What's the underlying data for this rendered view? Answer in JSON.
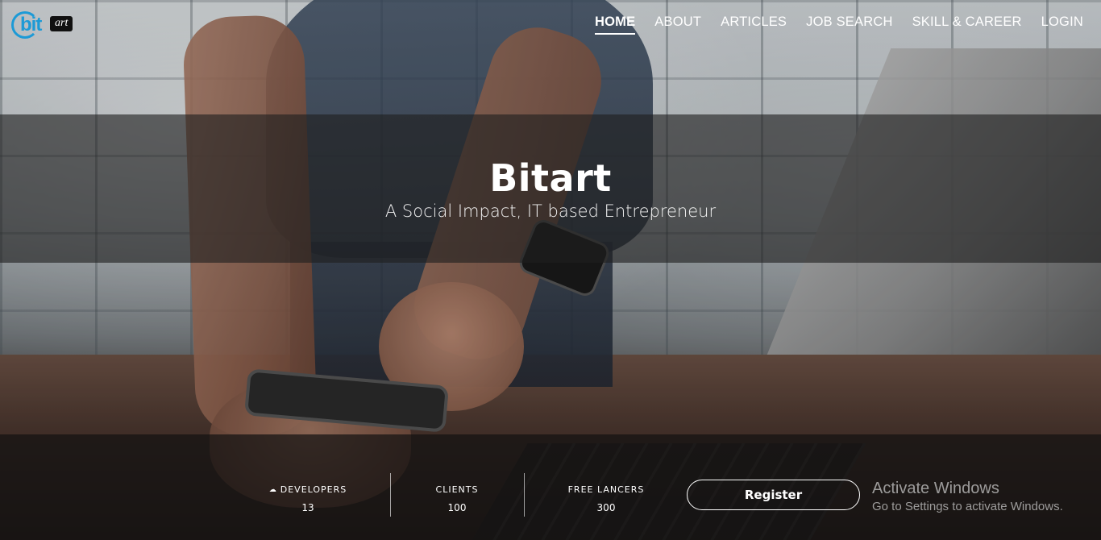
{
  "brand": {
    "logo_mark": "bit",
    "logo_tag": "art"
  },
  "nav": {
    "items": [
      {
        "label": "HOME",
        "active": true
      },
      {
        "label": "ABOUT",
        "active": false
      },
      {
        "label": "ARTICLES",
        "active": false
      },
      {
        "label": "JOB SEARCH",
        "active": false
      },
      {
        "label": "SKILL & CAREER",
        "active": false
      },
      {
        "label": "LOGIN",
        "active": false
      }
    ]
  },
  "hero": {
    "title": "Bitart",
    "subtitle": "A Social Impact, IT based Entrepreneur"
  },
  "stats": [
    {
      "label": "DEVELOPERS",
      "value": "13",
      "icon": "developers-icon"
    },
    {
      "label": "CLIENTS",
      "value": "100"
    },
    {
      "label": "FREE LANCERS",
      "value": "300"
    }
  ],
  "cta": {
    "register_label": "Register"
  },
  "os_watermark": {
    "title": "Activate Windows",
    "subtitle": "Go to Settings to activate Windows."
  },
  "colors": {
    "logo_blue": "#1d9ad6",
    "band_overlay": "#1e1e1e",
    "text": "#ffffff"
  }
}
